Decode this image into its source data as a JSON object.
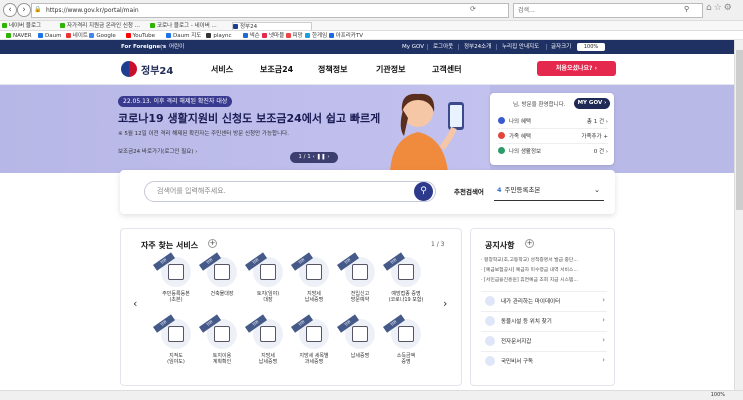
{
  "browser": {
    "url": "https://www.gov.kr/portal/main",
    "search_placeholder": "검색...",
    "tabs": [
      {
        "label": "네이버 블로그",
        "color": "#2db400"
      },
      {
        "label": "자가격리 지원금 온라인 신청 ...",
        "color": "#2db400"
      },
      {
        "label": "코로나 블로그 - 네이버 ...",
        "color": "#2db400"
      },
      {
        "label": "정부24",
        "color": "#1f3e8f"
      }
    ],
    "favorites": [
      "NAVER",
      "Daum",
      "네이트",
      "Google",
      "YouTube",
      "Daum 지도",
      "plaync",
      "넥슨",
      "넷마블",
      "피망",
      "한게임",
      "아프리카TV"
    ],
    "zoom": "100%"
  },
  "topbar": {
    "foreigners": "For Foreigners",
    "language": "어린이",
    "links": [
      "My GOV",
      "로그아웃",
      "정부24소개",
      "누리집 안내지도",
      "글자크기"
    ],
    "zoom_value": "100%"
  },
  "header": {
    "logo": "정부24",
    "menu": [
      "서비스",
      "보조금24",
      "정책정보",
      "기관정보",
      "고객센터"
    ],
    "join_button": "처음오셨나요?"
  },
  "banner": {
    "date": "22.05.13. 이후 격리 해제된 확진자 대상",
    "title": "코로나19 생활지원비 신청도 보조금24에서 쉽고 빠르게",
    "subtitle": "※ 5월 12일 이전 격리 해제된 확진자는 주민센터 방문 신청만 가능합니다.",
    "link": "보조금24 바로가기(로그인 필요) ›",
    "pager": "1 / 1"
  },
  "login_panel": {
    "greeting": "님, 방문을 환영합니다.",
    "mygov": "MY GOV",
    "rows": [
      {
        "label": "나의 혜택",
        "value": "총 1 건"
      },
      {
        "label": "가족 혜택",
        "value": "가족추가"
      },
      {
        "label": "나의 생활정보",
        "value": "0 건"
      }
    ]
  },
  "search": {
    "placeholder": "검색어를 입력해주세요.",
    "rec_label": "추천검색어",
    "rec_number": "4",
    "rec_value": "주민등록초본"
  },
  "services": {
    "title": "자주 찾는 서비스",
    "page": "1 / 3",
    "items": [
      {
        "label": "주민등록등본\n(초본)",
        "tag": "민원"
      },
      {
        "label": "건축물대장",
        "tag": "민원"
      },
      {
        "label": "토지(임야)\n대장",
        "tag": "민원"
      },
      {
        "label": "지방세\n납세증명",
        "tag": "민원"
      },
      {
        "label": "전입신고\n방문예약",
        "tag": "민원"
      },
      {
        "label": "예방접종 증명\n(코로나19 포함)",
        "tag": "민원"
      },
      {
        "label": "지적도\n(임야도)",
        "tag": "민원"
      },
      {
        "label": "토지이용\n계획확인",
        "tag": "민원"
      },
      {
        "label": "지방세\n납세증명",
        "tag": "민원"
      },
      {
        "label": "지방세 세목별\n과세증명",
        "tag": "민원"
      },
      {
        "label": "납세증명",
        "tag": "민원"
      },
      {
        "label": "소득금액\n증명",
        "tag": "민원"
      }
    ]
  },
  "notices": {
    "title": "공지사항",
    "items": [
      "· 평창학교(초,고등학교) 성적증명서 발급 중단...",
      "· [예금보험공사] 예금자 미수령금 내역 서비스...",
      "· [서민금융진흥원] 휴면예금 조회 지급 시스템..."
    ],
    "quick_links": [
      "내가 관리하는 마이데이터",
      "동물시설 등 위치 찾기",
      "전자문서지갑",
      "국민비서 구독"
    ]
  },
  "status": {
    "zoom": "100%"
  }
}
